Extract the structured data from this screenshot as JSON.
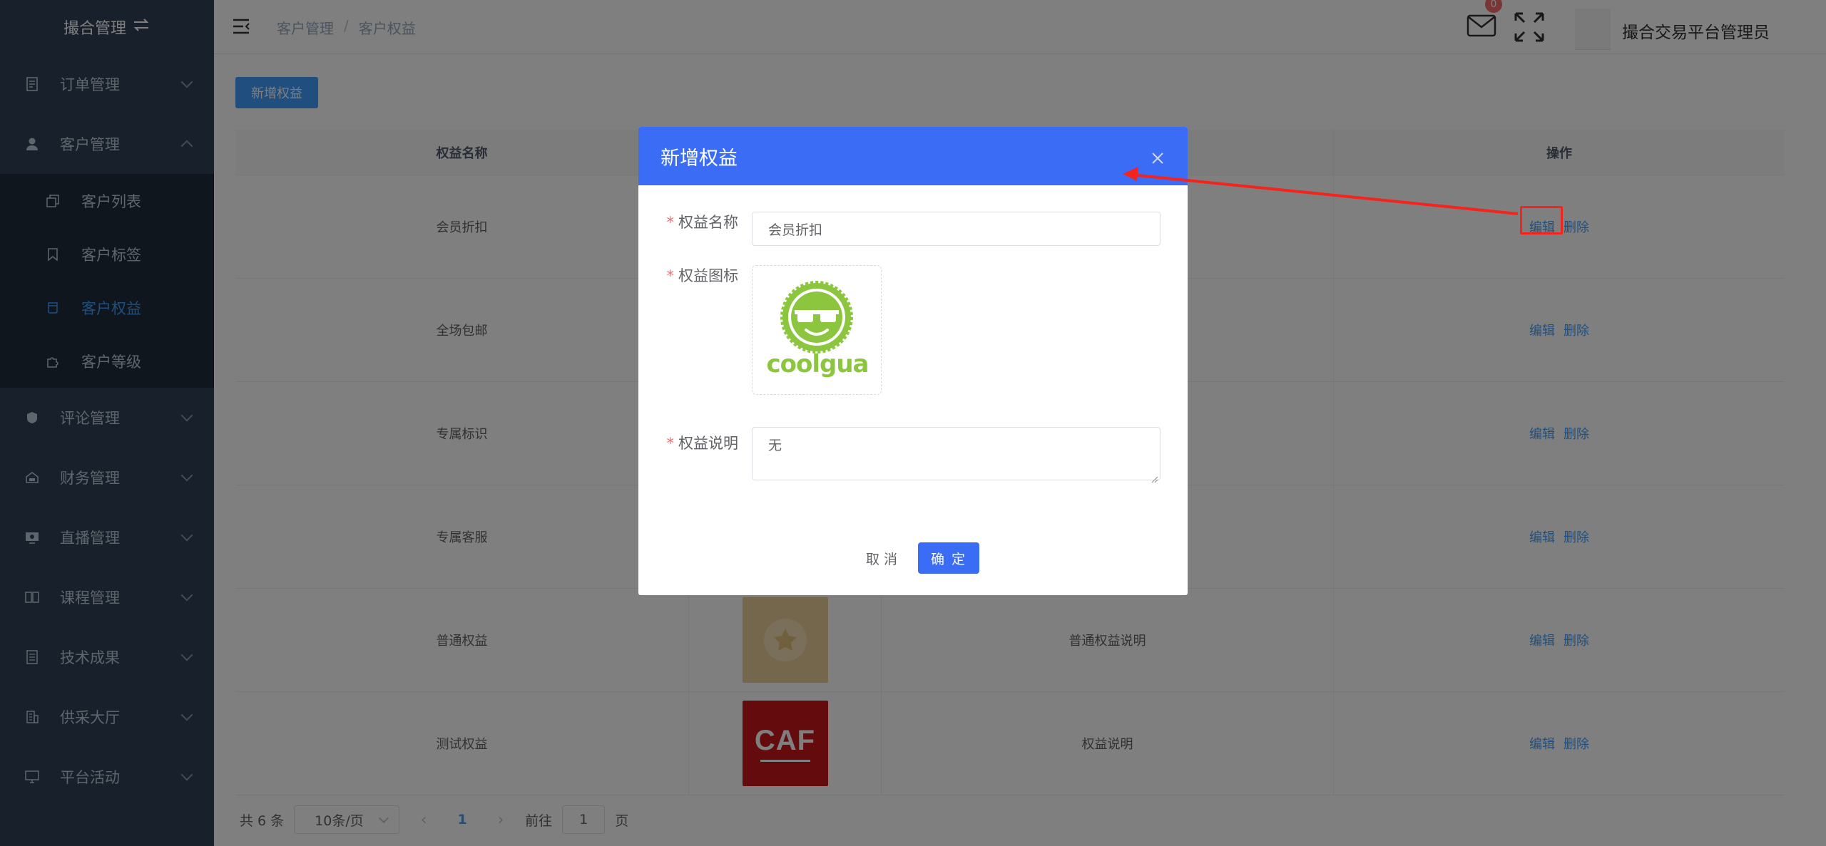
{
  "app": {
    "logo_text": "撮合管理",
    "user_name": "撮合交易平台管理员",
    "mail_badge": "0"
  },
  "sidebar": {
    "items": [
      {
        "label": "订单管理",
        "icon": "document-icon"
      },
      {
        "label": "客户管理",
        "icon": "user-icon",
        "expanded": true
      },
      {
        "label": "评论管理",
        "icon": "comment-icon"
      },
      {
        "label": "财务管理",
        "icon": "finance-icon"
      },
      {
        "label": "直播管理",
        "icon": "live-icon"
      },
      {
        "label": "课程管理",
        "icon": "book-icon"
      },
      {
        "label": "技术成果",
        "icon": "report-icon"
      },
      {
        "label": "供采大厅",
        "icon": "building-icon"
      },
      {
        "label": "平台活动",
        "icon": "monitor-icon"
      }
    ],
    "sub_items": [
      {
        "label": "客户列表",
        "icon": "copy-icon"
      },
      {
        "label": "客户标签",
        "icon": "bookmark-icon"
      },
      {
        "label": "客户权益",
        "icon": "cup-icon",
        "active": true
      },
      {
        "label": "客户等级",
        "icon": "puzzle-icon"
      }
    ]
  },
  "breadcrumb": [
    "客户管理",
    "客户权益"
  ],
  "toolbar": {
    "add_label": "新增权益"
  },
  "table": {
    "columns": [
      "权益名称",
      "操作"
    ],
    "rows": [
      {
        "name": "会员折扣",
        "desc": ""
      },
      {
        "name": "全场包邮",
        "desc": ""
      },
      {
        "name": "专属标识",
        "desc": ""
      },
      {
        "name": "专属客服",
        "desc": ""
      },
      {
        "name": "普通权益",
        "desc": "普通权益说明"
      },
      {
        "name": "测试权益",
        "desc": "权益说明"
      }
    ],
    "edit_label": "编辑",
    "delete_label": "删除"
  },
  "pagination": {
    "total": "共 6 条",
    "page_size": "10条/页",
    "current_page": "1",
    "goto_prefix": "前往",
    "goto_value": "1",
    "goto_suffix": "页"
  },
  "dialog": {
    "title": "新增权益",
    "name_label": "权益名称",
    "name_value": "会员折扣",
    "icon_label": "权益图标",
    "icon_brand_text": "coolgua",
    "desc_label": "权益说明",
    "desc_value": "无",
    "cancel_label": "取 消",
    "ok_label": "确 定",
    "required_mark": "*"
  },
  "colors": {
    "sidebar_bg": "#304156",
    "primary": "#3b6cf5",
    "accent": "#409eff",
    "annotation": "#f5231d",
    "coolgua_green": "#8cc63f",
    "caf_red": "#c8161d"
  },
  "caf_logo_text": "CAF"
}
